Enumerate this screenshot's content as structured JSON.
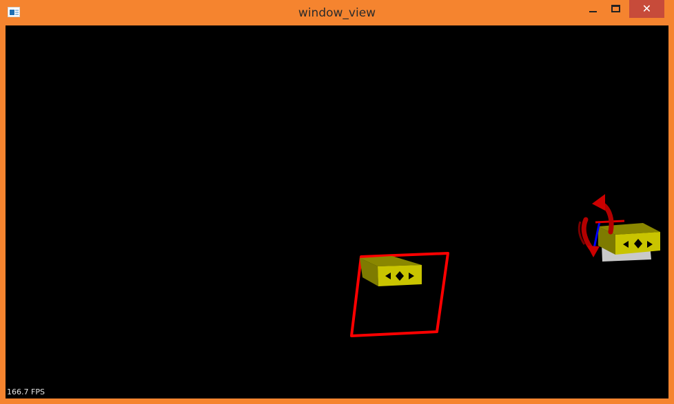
{
  "window": {
    "title": "window_view",
    "close_label": "✕"
  },
  "viewport": {
    "fps_label": "166.7 FPS",
    "background": "#000000"
  },
  "icons": [
    "app-icon",
    "minimize-icon",
    "maximize-icon",
    "close-icon"
  ],
  "colors": {
    "frame": "#f5842f",
    "close_button": "#c74b3a",
    "selection_frame": "#ff0000",
    "object_yellow": "#c9c400",
    "gizmo_rotate": "#cc0000",
    "gizmo_axis": "#0000ff"
  }
}
